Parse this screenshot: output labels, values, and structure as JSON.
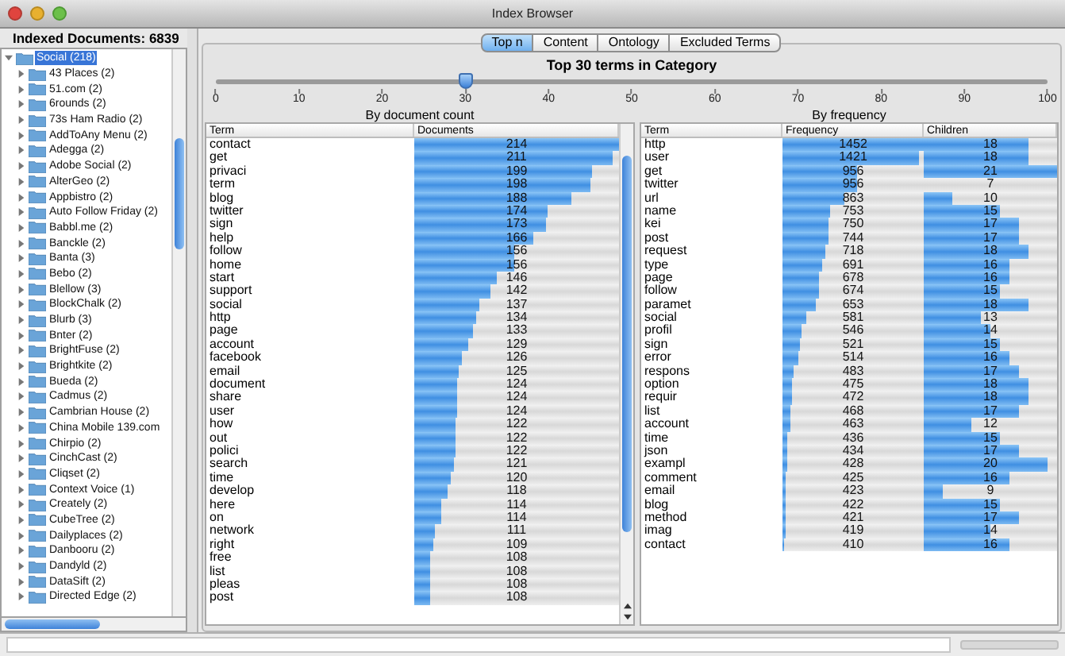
{
  "window": {
    "title": "Index Browser"
  },
  "sidebar": {
    "header": "Indexed Documents: 6839",
    "tree": [
      {
        "label": "Social (218)",
        "expanded": true,
        "selected": true,
        "children": [
          {
            "label": "43 Places (2)",
            "expanded": false
          },
          {
            "label": "51.com (2)",
            "expanded": false
          },
          {
            "label": "6rounds (2)",
            "expanded": false
          },
          {
            "label": "73s Ham Radio (2)",
            "expanded": false
          },
          {
            "label": "AddToAny Menu (2)",
            "expanded": false
          },
          {
            "label": "Adegga (2)",
            "expanded": false
          },
          {
            "label": "Adobe Social (2)",
            "expanded": false
          },
          {
            "label": "AlterGeo (2)",
            "expanded": false
          },
          {
            "label": "Appbistro (2)",
            "expanded": false
          },
          {
            "label": "Auto Follow Friday (2)",
            "expanded": false
          },
          {
            "label": "Babbl.me (2)",
            "expanded": false
          },
          {
            "label": "Banckle (2)",
            "expanded": false
          },
          {
            "label": "Banta (3)",
            "expanded": false
          },
          {
            "label": "Bebo (2)",
            "expanded": false
          },
          {
            "label": "Blellow (3)",
            "expanded": false
          },
          {
            "label": "BlockChalk (2)",
            "expanded": false
          },
          {
            "label": "Blurb (3)",
            "expanded": false
          },
          {
            "label": "Bnter (2)",
            "expanded": false
          },
          {
            "label": "BrightFuse (2)",
            "expanded": false
          },
          {
            "label": "Brightkite (2)",
            "expanded": false
          },
          {
            "label": "Bueda (2)",
            "expanded": false
          },
          {
            "label": "Cadmus (2)",
            "expanded": false
          },
          {
            "label": "Cambrian House (2)",
            "expanded": false
          },
          {
            "label": "China Mobile 139.com",
            "expanded": false
          },
          {
            "label": "Chirpio (2)",
            "expanded": false
          },
          {
            "label": "CinchCast (2)",
            "expanded": false
          },
          {
            "label": "Cliqset (2)",
            "expanded": false
          },
          {
            "label": "Context Voice (1)",
            "expanded": false
          },
          {
            "label": "Creately (2)",
            "expanded": false
          },
          {
            "label": "CubeTree (2)",
            "expanded": false
          },
          {
            "label": "Dailyplaces (2)",
            "expanded": false
          },
          {
            "label": "Danbooru (2)",
            "expanded": false
          },
          {
            "label": "Dandyld (2)",
            "expanded": false
          },
          {
            "label": "DataSift (2)",
            "expanded": false
          },
          {
            "label": "Directed Edge (2)",
            "expanded": false
          }
        ]
      }
    ]
  },
  "tabs": [
    {
      "label": "Top n",
      "selected": true
    },
    {
      "label": "Content",
      "selected": false
    },
    {
      "label": "Ontology",
      "selected": false
    },
    {
      "label": "Excluded Terms",
      "selected": false
    }
  ],
  "heading": "Top 30 terms in Category",
  "slider": {
    "level": 0.3,
    "ticks": [
      "0",
      "10",
      "20",
      "30",
      "40",
      "50",
      "60",
      "70",
      "80",
      "90",
      "100"
    ]
  },
  "doc_table": {
    "title": "By document count",
    "columns": [
      "Term",
      "Documents"
    ],
    "rows": [
      {
        "term": "contact",
        "documents": {
          "text": "214",
          "level": 1
        }
      },
      {
        "term": "get",
        "documents": {
          "text": "211",
          "level": 0.97
        }
      },
      {
        "term": "privaci",
        "documents": {
          "text": "199",
          "level": 0.87
        }
      },
      {
        "term": "term",
        "documents": {
          "text": "198",
          "level": 0.86
        }
      },
      {
        "term": "blog",
        "documents": {
          "text": "188",
          "level": 0.77
        }
      },
      {
        "term": "twitter",
        "documents": {
          "text": "174",
          "level": 0.65
        }
      },
      {
        "term": "sign",
        "documents": {
          "text": "173",
          "level": 0.64
        }
      },
      {
        "term": "help",
        "documents": {
          "text": "166",
          "level": 0.58
        }
      },
      {
        "term": "follow",
        "documents": {
          "text": "156",
          "level": 0.49
        }
      },
      {
        "term": "home",
        "documents": {
          "text": "156",
          "level": 0.49
        }
      },
      {
        "term": "start",
        "documents": {
          "text": "146",
          "level": 0.4
        }
      },
      {
        "term": "support",
        "documents": {
          "text": "142",
          "level": 0.37
        }
      },
      {
        "term": "social",
        "documents": {
          "text": "137",
          "level": 0.32
        }
      },
      {
        "term": "http",
        "documents": {
          "text": "134",
          "level": 0.3
        }
      },
      {
        "term": "page",
        "documents": {
          "text": "133",
          "level": 0.29
        }
      },
      {
        "term": "account",
        "documents": {
          "text": "129",
          "level": 0.26
        }
      },
      {
        "term": "facebook",
        "documents": {
          "text": "126",
          "level": 0.23
        }
      },
      {
        "term": "email",
        "documents": {
          "text": "125",
          "level": 0.22
        }
      },
      {
        "term": "document",
        "documents": {
          "text": "124",
          "level": 0.21
        }
      },
      {
        "term": "share",
        "documents": {
          "text": "124",
          "level": 0.21
        }
      },
      {
        "term": "user",
        "documents": {
          "text": "124",
          "level": 0.21
        }
      },
      {
        "term": "how",
        "documents": {
          "text": "122",
          "level": 0.2
        }
      },
      {
        "term": "out",
        "documents": {
          "text": "122",
          "level": 0.2
        }
      },
      {
        "term": "polici",
        "documents": {
          "text": "122",
          "level": 0.2
        }
      },
      {
        "term": "search",
        "documents": {
          "text": "121",
          "level": 0.19
        }
      },
      {
        "term": "time",
        "documents": {
          "text": "120",
          "level": 0.18
        }
      },
      {
        "term": "develop",
        "documents": {
          "text": "118",
          "level": 0.16
        }
      },
      {
        "term": "here",
        "documents": {
          "text": "114",
          "level": 0.13
        }
      },
      {
        "term": "on",
        "documents": {
          "text": "114",
          "level": 0.13
        }
      },
      {
        "term": "network",
        "documents": {
          "text": "111",
          "level": 0.1
        }
      },
      {
        "term": "right",
        "documents": {
          "text": "109",
          "level": 0.09
        }
      },
      {
        "term": "free",
        "documents": {
          "text": "108",
          "level": 0.08
        }
      },
      {
        "term": "list",
        "documents": {
          "text": "108",
          "level": 0.08
        }
      },
      {
        "term": "pleas",
        "documents": {
          "text": "108",
          "level": 0.08
        }
      },
      {
        "term": "post",
        "documents": {
          "text": "108",
          "level": 0.08
        }
      }
    ]
  },
  "freq_table": {
    "title": "By frequency",
    "columns": [
      "Term",
      "Frequency",
      "Children"
    ],
    "rows": [
      {
        "term": "http",
        "frequency": {
          "text": "1452",
          "level": 1
        },
        "children": {
          "text": "18",
          "level": 0.79
        }
      },
      {
        "term": "user",
        "frequency": {
          "text": "1421",
          "level": 0.97
        },
        "children": {
          "text": "18",
          "level": 0.79
        }
      },
      {
        "term": "get",
        "frequency": {
          "text": "956",
          "level": 0.53
        },
        "children": {
          "text": "21",
          "level": 1
        }
      },
      {
        "term": "twitter",
        "frequency": {
          "text": "956",
          "level": 0.53
        },
        "children": {
          "text": "7"
        }
      },
      {
        "term": "url",
        "frequency": {
          "text": "863",
          "level": 0.44
        },
        "children": {
          "text": "10",
          "level": 0.21
        }
      },
      {
        "term": "name",
        "frequency": {
          "text": "753",
          "level": 0.34
        },
        "children": {
          "text": "15",
          "level": 0.57
        }
      },
      {
        "term": "kei",
        "frequency": {
          "text": "750",
          "level": 0.33
        },
        "children": {
          "text": "17",
          "level": 0.71
        }
      },
      {
        "term": "post",
        "frequency": {
          "text": "744",
          "level": 0.33
        },
        "children": {
          "text": "17",
          "level": 0.71
        }
      },
      {
        "term": "request",
        "frequency": {
          "text": "718",
          "level": 0.3
        },
        "children": {
          "text": "18",
          "level": 0.79
        }
      },
      {
        "term": "type",
        "frequency": {
          "text": "691",
          "level": 0.28
        },
        "children": {
          "text": "16",
          "level": 0.64
        }
      },
      {
        "term": "page",
        "frequency": {
          "text": "678",
          "level": 0.26
        },
        "children": {
          "text": "16",
          "level": 0.64
        }
      },
      {
        "term": "follow",
        "frequency": {
          "text": "674",
          "level": 0.26
        },
        "children": {
          "text": "15",
          "level": 0.57
        }
      },
      {
        "term": "paramet",
        "frequency": {
          "text": "653",
          "level": 0.24
        },
        "children": {
          "text": "18",
          "level": 0.79
        }
      },
      {
        "term": "social",
        "frequency": {
          "text": "581",
          "level": 0.17
        },
        "children": {
          "text": "13",
          "level": 0.43
        }
      },
      {
        "term": "profil",
        "frequency": {
          "text": "546",
          "level": 0.14
        },
        "children": {
          "text": "14",
          "level": 0.5
        }
      },
      {
        "term": "sign",
        "frequency": {
          "text": "521",
          "level": 0.12
        },
        "children": {
          "text": "15",
          "level": 0.57
        }
      },
      {
        "term": "error",
        "frequency": {
          "text": "514",
          "level": 0.11
        },
        "children": {
          "text": "16",
          "level": 0.64
        }
      },
      {
        "term": "respons",
        "frequency": {
          "text": "483",
          "level": 0.08
        },
        "children": {
          "text": "17",
          "level": 0.71
        }
      },
      {
        "term": "option",
        "frequency": {
          "text": "475",
          "level": 0.07
        },
        "children": {
          "text": "18",
          "level": 0.79
        }
      },
      {
        "term": "requir",
        "frequency": {
          "text": "472",
          "level": 0.07
        },
        "children": {
          "text": "18",
          "level": 0.79
        }
      },
      {
        "term": "list",
        "frequency": {
          "text": "468",
          "level": 0.06
        },
        "children": {
          "text": "17",
          "level": 0.71
        }
      },
      {
        "term": "account",
        "frequency": {
          "text": "463",
          "level": 0.06
        },
        "children": {
          "text": "12",
          "level": 0.36
        }
      },
      {
        "term": "time",
        "frequency": {
          "text": "436",
          "level": 0.03
        },
        "children": {
          "text": "15",
          "level": 0.57
        }
      },
      {
        "term": "json",
        "frequency": {
          "text": "434",
          "level": 0.03
        },
        "children": {
          "text": "17",
          "level": 0.71
        }
      },
      {
        "term": "exampl",
        "frequency": {
          "text": "428",
          "level": 0.03
        },
        "children": {
          "text": "20",
          "level": 0.93
        }
      },
      {
        "term": "comment",
        "frequency": {
          "text": "425",
          "level": 0.02
        },
        "children": {
          "text": "16",
          "level": 0.64
        }
      },
      {
        "term": "email",
        "frequency": {
          "text": "423",
          "level": 0.02
        },
        "children": {
          "text": "9",
          "level": 0.14
        }
      },
      {
        "term": "blog",
        "frequency": {
          "text": "422",
          "level": 0.02
        },
        "children": {
          "text": "15",
          "level": 0.57
        }
      },
      {
        "term": "method",
        "frequency": {
          "text": "421",
          "level": 0.02
        },
        "children": {
          "text": "17",
          "level": 0.71
        }
      },
      {
        "term": "imag",
        "frequency": {
          "text": "419",
          "level": 0.02
        },
        "children": {
          "text": "14",
          "level": 0.5
        }
      },
      {
        "term": "contact",
        "frequency": {
          "text": "410",
          "level": 0.01
        },
        "children": {
          "text": "16",
          "level": 0.64
        }
      }
    ]
  }
}
